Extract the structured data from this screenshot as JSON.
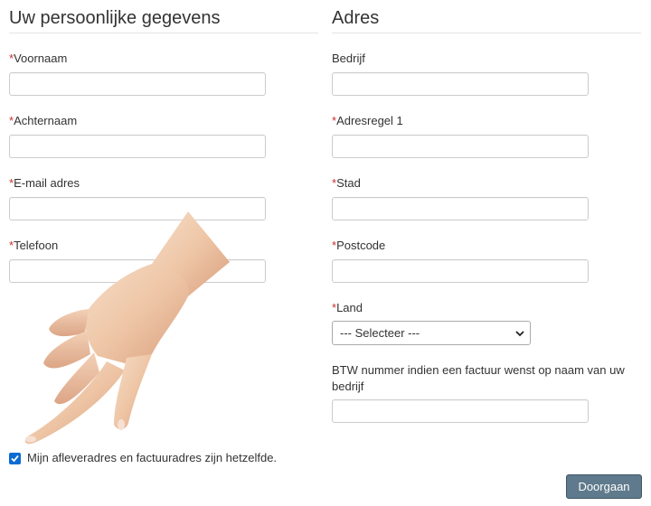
{
  "personal": {
    "title": "Uw persoonlijke gegevens",
    "required_marker": "*",
    "firstname_label": "Voornaam",
    "lastname_label": "Achternaam",
    "email_label": "E-mail adres",
    "phone_label": "Telefoon"
  },
  "address": {
    "title": "Adres",
    "required_marker": "*",
    "company_label": "Bedrijf",
    "line1_label": "Adresregel 1",
    "city_label": "Stad",
    "postcode_label": "Postcode",
    "country_label": "Land",
    "country_selected": "--- Selecteer ---",
    "vat_label_line1": "BTW nummer indien een factuur wenst op naam van uw",
    "vat_label_line2": "bedrijf"
  },
  "same_address": {
    "label": "Mijn afleveradres en factuuradres zijn hetzelfde.",
    "checked": true
  },
  "submit_label": "Doorgaan",
  "colors": {
    "required": "#c9302c",
    "checkbox": "#0b6bd3",
    "button": "#5f7a8c"
  }
}
